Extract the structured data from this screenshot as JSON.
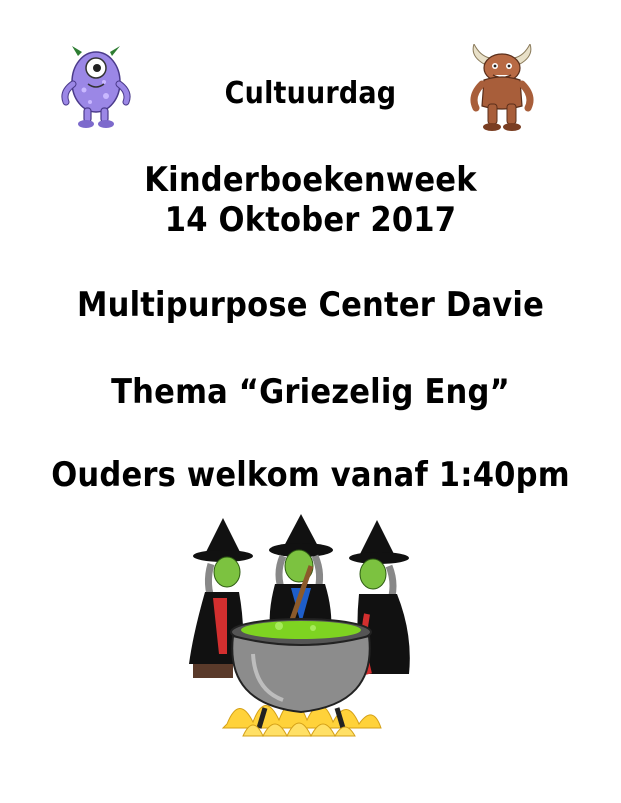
{
  "flyer": {
    "title": "Cultuurdag",
    "subtitle": "Kinderboekenweek",
    "date": "14 Oktober 2017",
    "venue": "Multipurpose Center Davie",
    "theme": "Thema “Griezelig Eng”",
    "parents": "Ouders welkom vanaf  1:40pm"
  },
  "colors": {
    "purple_monster": "#9b87e6",
    "brown_monster": "#b86a44",
    "witch_skin": "#7cc240",
    "cauldron": "#8c8c8c",
    "brew": "#7ed321",
    "fire": "#ffd23a"
  }
}
